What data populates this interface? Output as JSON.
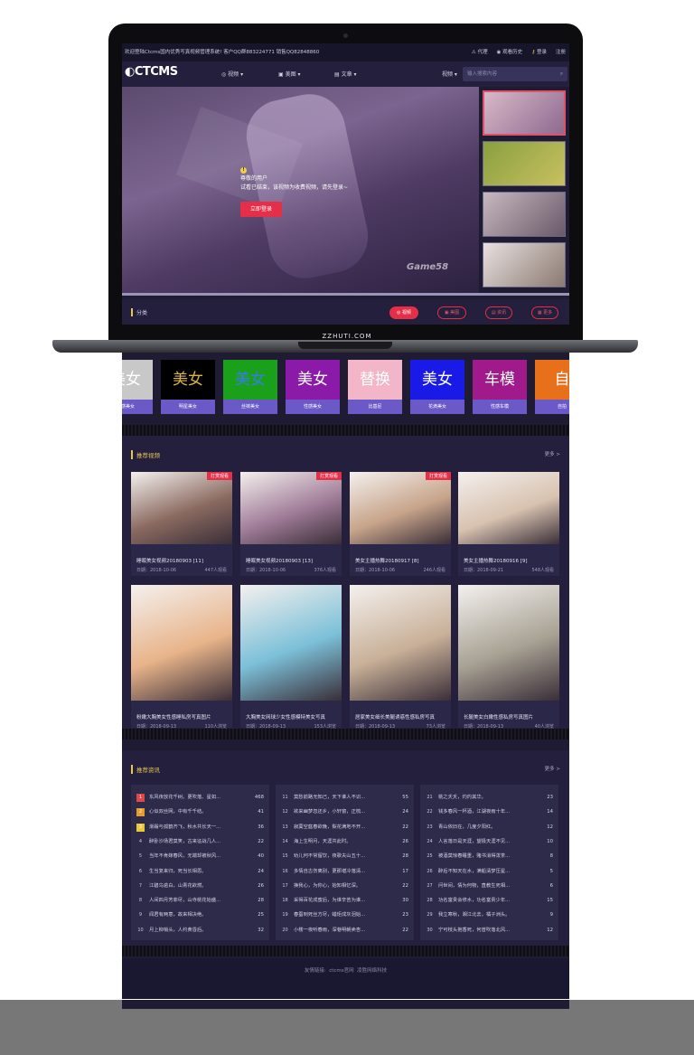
{
  "device": {
    "brand": "ZZHUTI.COM"
  },
  "topbar": {
    "welcome": "欢迎登陆Ctcms国内优秀写真视频管理系统! 客户QQ群883224771 销售QQ82848860",
    "agent": "代理",
    "history": "观看历史",
    "login": "登录",
    "register": "注册"
  },
  "nav": {
    "logo": "CTCMS",
    "video": "视频",
    "photo": "美图",
    "article": "文章",
    "search_type": "视频",
    "search_placeholder": "输入搜索内容"
  },
  "player": {
    "notice_title": "尊敬的用户",
    "notice_body": "试看已结束，该视频为收费视频，请先登录~",
    "login_button": "立即登录",
    "watermark": "Game58"
  },
  "category_bar": {
    "label": "分类",
    "buttons": [
      {
        "label": "视频",
        "active": true
      },
      {
        "label": "美图",
        "active": false
      },
      {
        "label": "资讯",
        "active": false
      },
      {
        "label": "更多",
        "active": false
      }
    ]
  },
  "tiles": [
    {
      "text": "美女",
      "name": "性感美女",
      "bg": "#c8c8c8",
      "fg": "#ffffff"
    },
    {
      "text": "美女",
      "name": "明星美女",
      "bg": "#000000",
      "fg": "#d8b24a"
    },
    {
      "text": "美女",
      "name": "丝袜美女",
      "bg": "#1aa01a",
      "fg": "#3a7be8"
    },
    {
      "text": "美女",
      "name": "性感美女",
      "bg": "#8c1aa8",
      "fg": "#ffffff"
    },
    {
      "text": "替换",
      "name": "比基尼",
      "bg": "#f2b6c8",
      "fg": "#ffffff"
    },
    {
      "text": "美女",
      "name": "花滴美女",
      "bg": "#1a1ae6",
      "fg": "#ffffff"
    },
    {
      "text": "车模",
      "name": "性感车模",
      "bg": "#a01a8c",
      "fg": "#ffffff"
    },
    {
      "text": "自",
      "name": "自拍",
      "bg": "#e8701a",
      "fg": "#ffffff"
    }
  ],
  "recommended_videos": {
    "title": "推荐视频",
    "more": "更多 >",
    "items": [
      {
        "title": "睡眠美女视频20180903 [11]",
        "date": "日期：2018-10-06",
        "views": "447人观看",
        "badge": "打赏观看",
        "bg": "#8a6a60"
      },
      {
        "title": "睡眠美女视频20180903 [13]",
        "date": "日期：2018-10-06",
        "views": "376人观看",
        "badge": "打赏观看",
        "bg": "#a07c98"
      },
      {
        "title": "美女主播热舞20180917 [8]",
        "date": "日期：2018-10-06",
        "views": "246人观看",
        "badge": "打赏观看",
        "bg": "#c7a48a"
      },
      {
        "title": "美女主播热舞20180916 [9]",
        "date": "日期：2018-09-21",
        "views": "548人观看",
        "badge": "",
        "bg": "#d8c2b0"
      },
      {
        "title": "粉嫩大胸美女性感睡私房写真图片",
        "date": "日期：2018-09-13",
        "views": "110人浏览",
        "badge": "",
        "bg": "#e8b48a"
      },
      {
        "title": "大胸美女网球少女性感模特美女写真",
        "date": "日期：2018-09-13",
        "views": "153人浏览",
        "badge": "",
        "bg": "#7cc0d8"
      },
      {
        "title": "居家美女细长美腿诱惑性感私房写真",
        "date": "日期：2018-09-13",
        "views": "73人浏览",
        "badge": "",
        "bg": "#c8b098"
      },
      {
        "title": "长腿美女白嫩性感私房写真图片",
        "date": "日期：2018-09-13",
        "views": "40人浏览",
        "badge": "",
        "bg": "#a8a294"
      }
    ]
  },
  "recommended_news": {
    "title": "推荐资讯",
    "more": "更多 >",
    "columns": [
      [
        {
          "n": "1",
          "t": "东风夜放花千树。更吹落、星如...",
          "c": "468"
        },
        {
          "n": "2",
          "t": "心似双丝网，中有千千结。",
          "c": "41"
        },
        {
          "n": "3",
          "t": "渐霜与孤鹤齐飞，秋水共长天一...",
          "c": "36"
        },
        {
          "n": "4",
          "t": "醉卧沙场君莫笑，古来征战几人...",
          "c": "22"
        },
        {
          "n": "5",
          "t": "当年不肯嫁春风，无端却被秋风...",
          "c": "40"
        },
        {
          "n": "6",
          "t": "生当复来归，死当长相思。",
          "c": "24"
        },
        {
          "n": "7",
          "t": "江碧鸟逾白，山青花欲燃。",
          "c": "26"
        },
        {
          "n": "8",
          "t": "人间四月芳菲尽，山寺桃花始盛...",
          "c": "28"
        },
        {
          "n": "9",
          "t": "闻君有两意，故来相决绝。",
          "c": "25"
        },
        {
          "n": "10",
          "t": "月上柳梢头，人约黄昏后。",
          "c": "32"
        }
      ],
      [
        {
          "n": "11",
          "t": "莫愁前路无知己，天下谁人不识...",
          "c": "55"
        },
        {
          "n": "12",
          "t": "欲来幽梦忽还乡，小轩窗，正梳...",
          "c": "24"
        },
        {
          "n": "13",
          "t": "寂寞空庭春欲晚，梨花满地不开...",
          "c": "22"
        },
        {
          "n": "14",
          "t": "海上生明月，天涯共此时。",
          "c": "26"
        },
        {
          "n": "15",
          "t": "劝儿何不常留饮，夜歌夫山五十...",
          "c": "28"
        },
        {
          "n": "16",
          "t": "多情自古伤离别，更那堪冷落清...",
          "c": "17"
        },
        {
          "n": "17",
          "t": "换我心，为你心，始知相忆深。",
          "c": "22"
        },
        {
          "n": "18",
          "t": "采得百花成蜜后，为谁辛苦为谁...",
          "c": "30"
        },
        {
          "n": "19",
          "t": "春蚕到死丝方尽，蜡炬成灰泪始...",
          "c": "23"
        },
        {
          "n": "20",
          "t": "小楼一夜听春雨，深巷明朝卖杏...",
          "c": "22"
        }
      ],
      [
        {
          "n": "21",
          "t": "桃之夭夭，灼灼其华。",
          "c": "23"
        },
        {
          "n": "22",
          "t": "钱多春风一杯酒，江湖夜雨十年...",
          "c": "14"
        },
        {
          "n": "23",
          "t": "青山依旧在，几度夕阳红。",
          "c": "12"
        },
        {
          "n": "24",
          "t": "人言落日是天涯，望极天涯不见...",
          "c": "10"
        },
        {
          "n": "25",
          "t": "被酒莫惊春睡重，赌书消得泼茶...",
          "c": "8"
        },
        {
          "n": "26",
          "t": "醉后不知天在水，满船清梦压星...",
          "c": "5"
        },
        {
          "n": "27",
          "t": "问世间，情为何物，直教生死相...",
          "c": "6"
        },
        {
          "n": "28",
          "t": "功名富贵会修水，功名富贵少年...",
          "c": "15"
        },
        {
          "n": "29",
          "t": "我立寒秋，湘江北去，橘子洲头。",
          "c": "9"
        },
        {
          "n": "30",
          "t": "宁可枝头抱香死，何曾吹落北风...",
          "c": "12"
        }
      ]
    ]
  },
  "footer": {
    "links_label": "友情链接:",
    "link1": "ctcms官网",
    "link2": "凌胜网络科技"
  }
}
